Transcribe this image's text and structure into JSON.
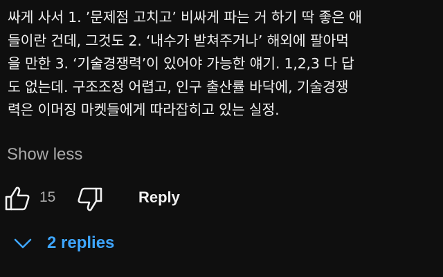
{
  "comment": {
    "text": "싸게 사서 1. ’문제점 고치고’ 비싸게 파는 거 하기 딱 좋은 애\n들이란 건데, 그것도 2. ‘내수가 받쳐주거나’ 해외에 팔아먹\n을 만한 3. ‘기술경쟁력’이 있어야 가능한 얘기. 1,2,3 다 답\n도 없는데. 구조조정 어렵고, 인구 출산률 바닥에, 기술경쟁\n력은 이머징 마켓들에게 따라잡히고 있는 실정.",
    "show_less_label": "Show less"
  },
  "actions": {
    "like_icon": "thumbs-up-icon",
    "like_count": "15",
    "dislike_icon": "thumbs-down-icon",
    "reply_label": "Reply"
  },
  "replies": {
    "chevron_icon": "chevron-down-icon",
    "label": "2 replies",
    "color": "#3ea6ff"
  },
  "theme": {
    "background": "#0f0f0f",
    "text": "#f1f1f1",
    "muted": "#aaaaaa"
  }
}
